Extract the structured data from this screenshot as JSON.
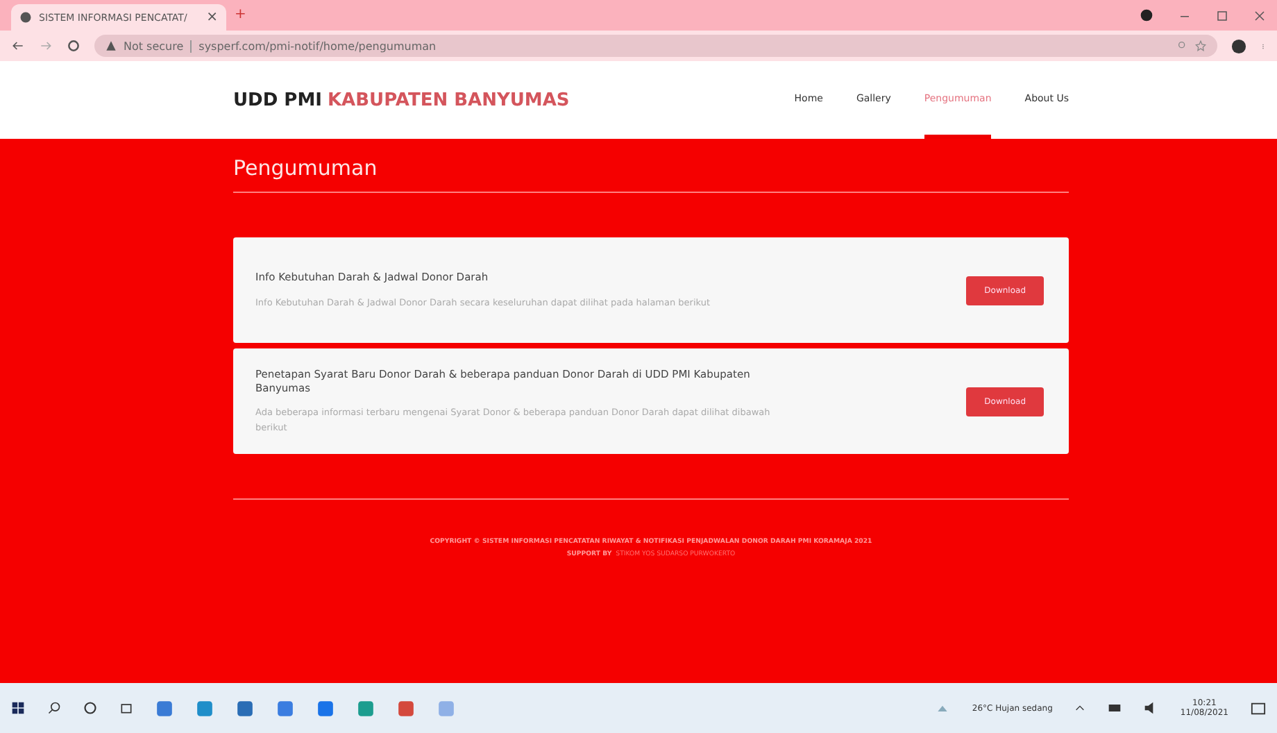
{
  "browser": {
    "tab_title": "SISTEM INFORMASI PENCATAT/",
    "tab_close": "×",
    "new_tab": "+",
    "security": "Not secure",
    "url": "sysperf.com/pmi-notif/home/pengumuman"
  },
  "navbar": {
    "brand": "UDD PMI",
    "brand_highlight": "KABUPATEN BANYUMAS",
    "links": [
      {
        "label": "Home",
        "selected": false
      },
      {
        "label": "Gallery",
        "selected": false
      },
      {
        "label": "Pengumuman",
        "selected": true
      },
      {
        "label": "About Us",
        "selected": false
      }
    ]
  },
  "page_title": "Pengumuman",
  "announcements": [
    {
      "title": "Info Kebutuhan Darah & Jadwal Donor Darah",
      "description": "Info Kebutuhan Darah & Jadwal Donor Darah secara keseluruhan dapat dilihat pada halaman berikut",
      "button": "Download"
    },
    {
      "title": "Penetapan Syarat Baru Donor Darah & beberapa panduan Donor Darah di UDD PMI Kabupaten Banyumas",
      "description": "Ada beberapa informasi terbaru mengenai Syarat Donor & beberapa panduan Donor Darah dapat dilihat dibawah berikut",
      "button": "Download"
    }
  ],
  "footer": {
    "copyright": "COPYRIGHT © SISTEM INFORMASI PENCATATAN RIWAYAT & NOTIFIKASI PENJADWALAN DONOR DARAH PMI KORAMAJA 2021",
    "support_label": "SUPPORT BY",
    "support_link": "STIKOM YOS SUDARSO PURWOKERTO"
  },
  "taskbar": {
    "weather": "26°C Hujan sedang",
    "time": "10:21",
    "date": "11/08/2021"
  }
}
